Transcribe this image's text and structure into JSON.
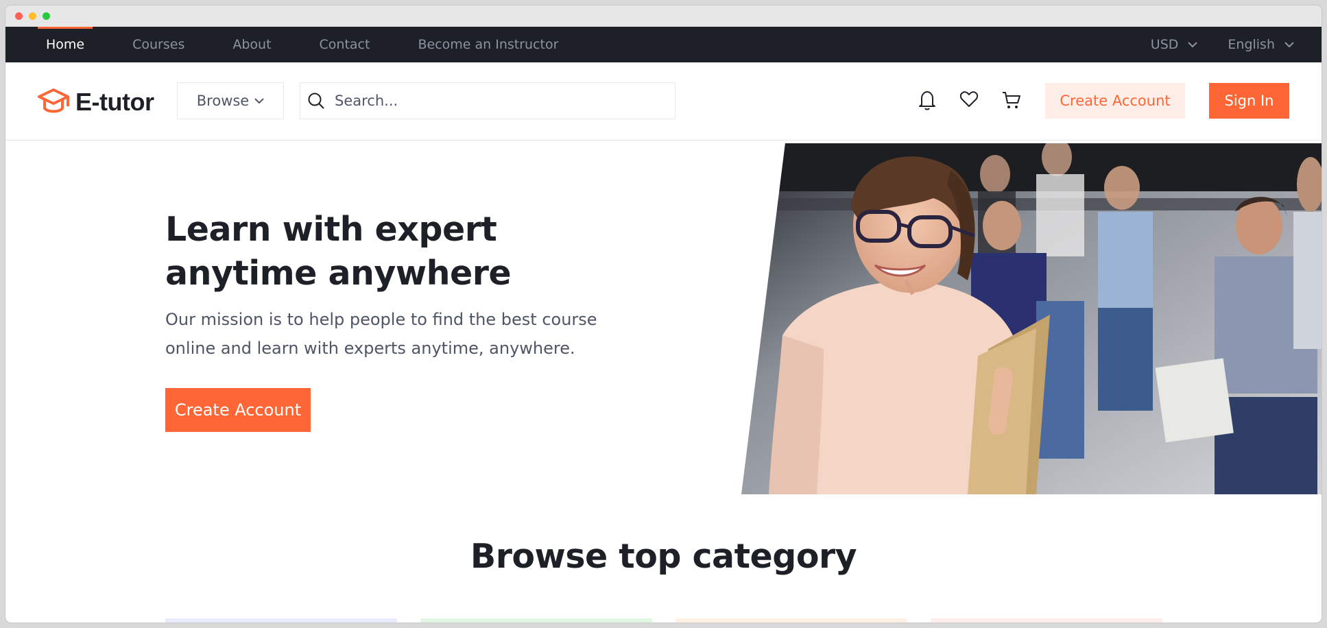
{
  "window": {
    "controls": [
      "close",
      "minimize",
      "maximize"
    ]
  },
  "topnav": {
    "links": [
      {
        "label": "Home",
        "active": true
      },
      {
        "label": "Courses",
        "active": false
      },
      {
        "label": "About",
        "active": false
      },
      {
        "label": "Contact",
        "active": false
      },
      {
        "label": "Become an Instructor",
        "active": false
      }
    ],
    "currency": "USD",
    "language": "English"
  },
  "header": {
    "logo_text": "E-tutor",
    "browse_label": "Browse",
    "search_placeholder": "Search...",
    "icons": [
      "bell-icon",
      "heart-icon",
      "cart-icon"
    ],
    "create_account_label": "Create Account",
    "sign_in_label": "Sign In"
  },
  "hero": {
    "title_line1": "Learn with expert",
    "title_line2": "anytime anywhere",
    "description_line1": "Our mission is to help people to find the best course",
    "description_line2": "online and learn with experts anytime, anywhere.",
    "cta_label": "Create Account"
  },
  "categories": {
    "title": "Browse top category",
    "card_colors": [
      "#ebebff",
      "#e1f7e3",
      "#fff2e5",
      "#ffeeeb"
    ]
  },
  "colors": {
    "primary": "#ff6636",
    "primary_light": "#ffeee8",
    "dark": "#1d2026",
    "muted": "#8c94a3",
    "text": "#4e5566"
  }
}
